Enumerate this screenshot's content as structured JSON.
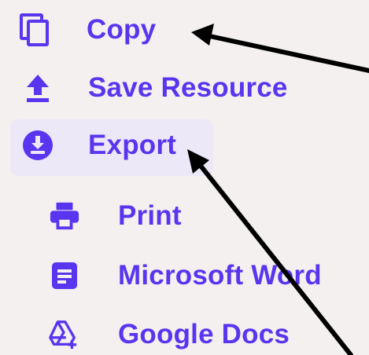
{
  "menu": {
    "items": [
      {
        "label": "Copy",
        "icon": "copy-icon"
      },
      {
        "label": "Save Resource",
        "icon": "upload-icon"
      },
      {
        "label": "Export",
        "icon": "download-circle-icon"
      }
    ],
    "export_submenu": [
      {
        "label": "Print",
        "icon": "printer-icon"
      },
      {
        "label": "Microsoft Word",
        "icon": "document-icon"
      },
      {
        "label": "Google Docs",
        "icon": "google-drive-icon"
      }
    ]
  },
  "colors": {
    "accent": "#5a35f0",
    "background": "#f4f0ef",
    "highlight": "#ece8f8",
    "annotation": "#000000"
  }
}
